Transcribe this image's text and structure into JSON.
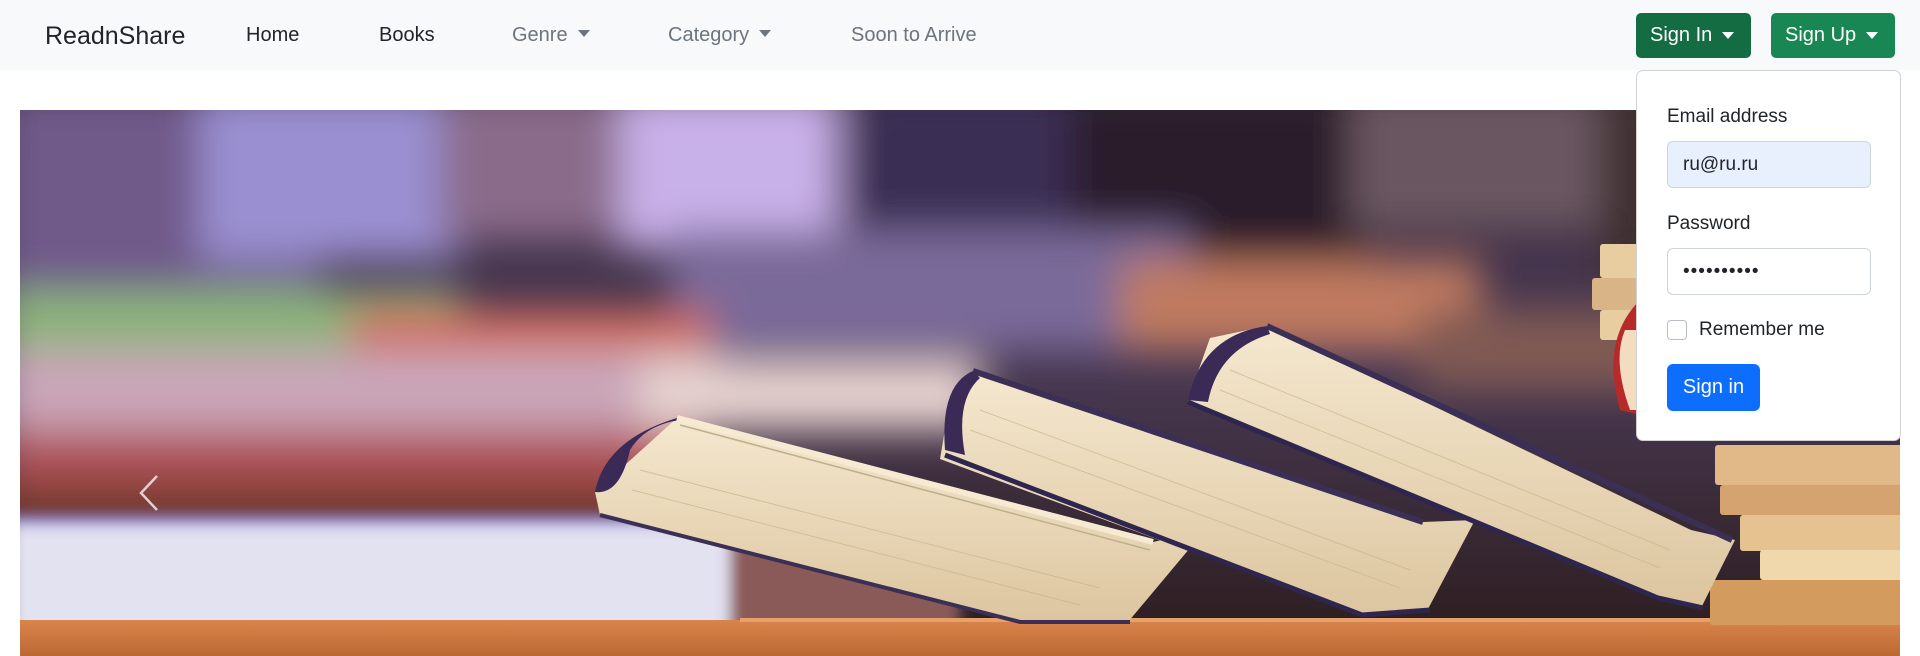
{
  "navbar": {
    "brand": "ReadnShare",
    "links": [
      {
        "label": "Home"
      },
      {
        "label": "Books"
      },
      {
        "label": "Genre"
      },
      {
        "label": "Category"
      },
      {
        "label": "Soon to Arrive"
      }
    ],
    "signin_label": "Sign In",
    "signup_label": "Sign Up"
  },
  "signin_form": {
    "email_label": "Email address",
    "email_value": "ru@ru.ru",
    "password_label": "Password",
    "password_value": "••••••••••",
    "remember_label": "Remember me",
    "submit_label": "Sign in"
  },
  "carousel": {
    "prev_icon": "chevron-left-icon"
  },
  "colors": {
    "navbar_bg": "#f8f9fa",
    "signin_btn": "#146c43",
    "signup_btn": "#198754",
    "primary": "#0d6efd",
    "autofill_bg": "#e8f0fe"
  }
}
